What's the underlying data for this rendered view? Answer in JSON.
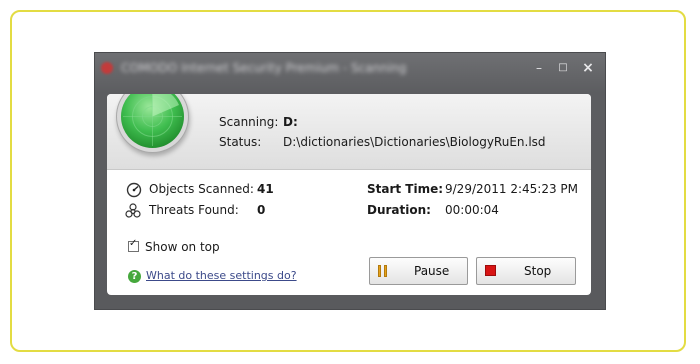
{
  "window": {
    "title": "COMODO Internet Security Premium - Scanning",
    "controls": [
      "–",
      "□",
      "×"
    ]
  },
  "scan": {
    "scanning_label": "Scanning:",
    "scanning_value": "D:",
    "status_label": "Status:",
    "status_value": "D:\\dictionaries\\Dictionaries\\BiologyRuEn.lsd"
  },
  "stats": {
    "objects_label": "Objects Scanned:",
    "objects_value": "41",
    "threats_label": "Threats Found:",
    "threats_value": "0",
    "start_label": "Start Time:",
    "start_value": "9/29/2011 2:45:23 PM",
    "duration_label": "Duration:",
    "duration_value": "00:00:04"
  },
  "options": {
    "show_on_top_label": "Show on top",
    "show_on_top_checked": true,
    "help_link": "What do these settings do?"
  },
  "buttons": {
    "pause_label": "Pause",
    "stop_label": "Stop"
  },
  "icons": {
    "radar": "radar-scanner-icon",
    "objects": "gauge-icon",
    "threats": "biohazard-icon",
    "help": "help-icon",
    "pause": "pause-icon",
    "stop": "stop-icon"
  },
  "colors": {
    "accent_green": "#3fbd4f",
    "stop_red": "#d81414",
    "pause_orange": "#e6a21b",
    "frame_yellow": "#e3dc43"
  }
}
